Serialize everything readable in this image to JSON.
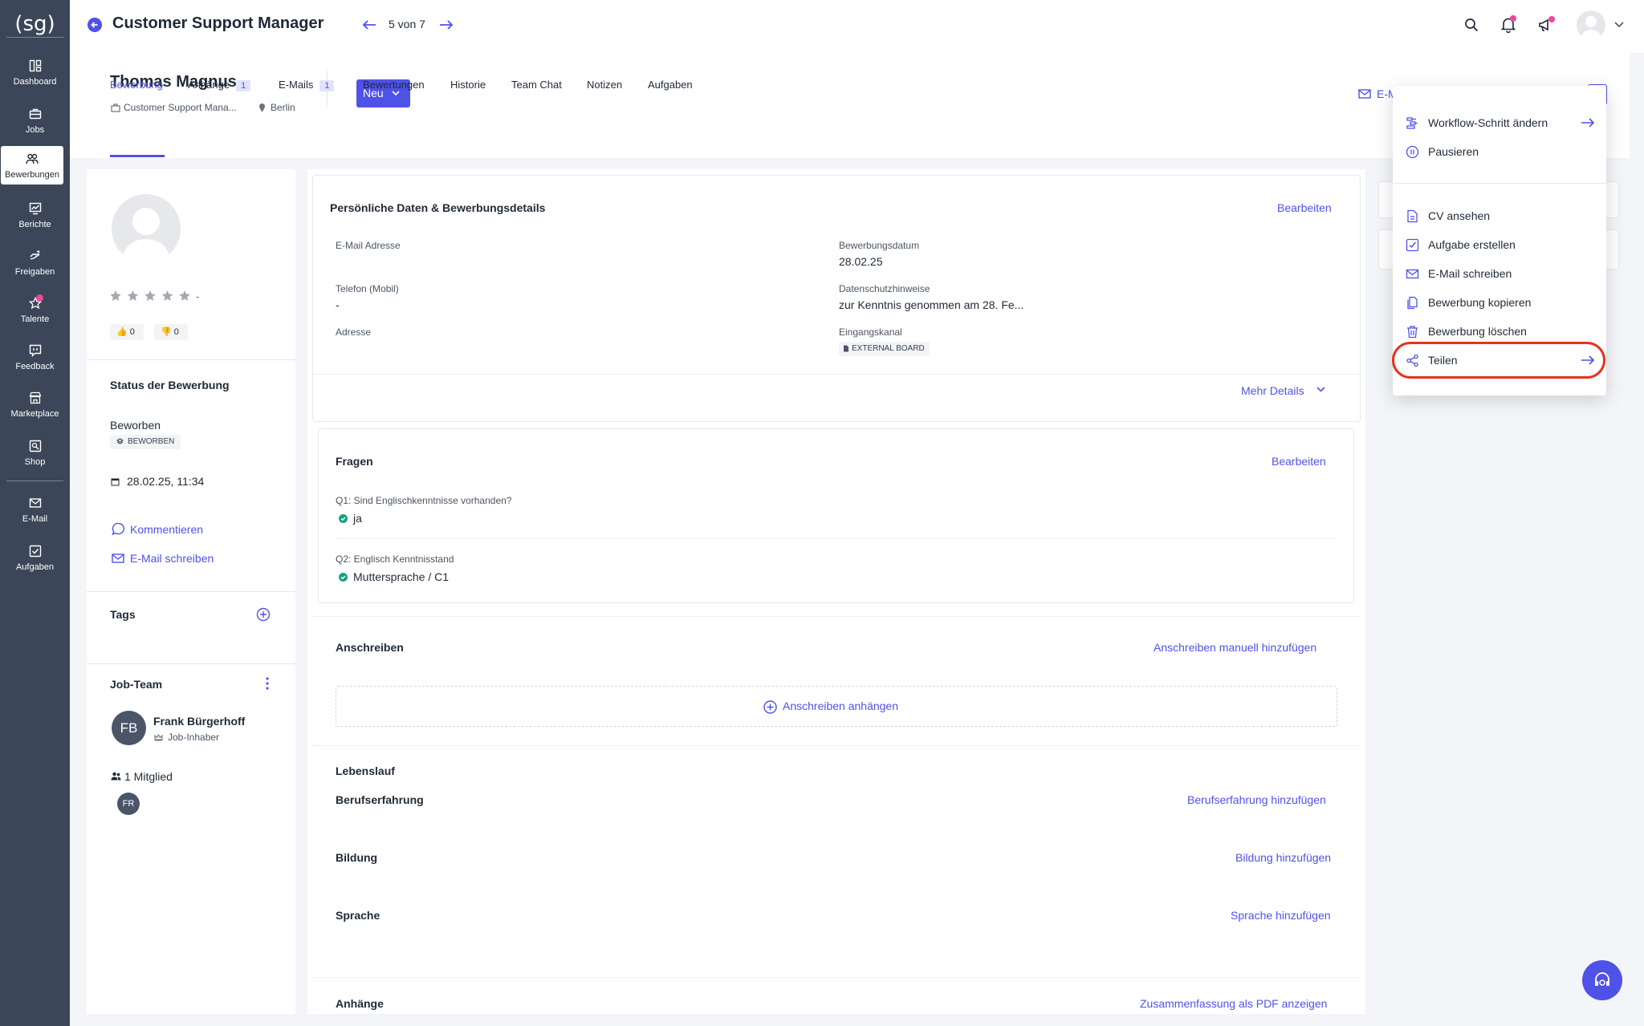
{
  "brand": {
    "logo": "(sg)"
  },
  "sidebar": {
    "items": [
      {
        "label": "Dashboard",
        "icon": "dashboard-icon"
      },
      {
        "label": "Jobs",
        "icon": "briefcase-icon"
      },
      {
        "label": "Bewerbungen",
        "icon": "people-icon"
      },
      {
        "label": "Berichte",
        "icon": "chart-icon"
      },
      {
        "label": "Freigaben",
        "icon": "hand-icon"
      },
      {
        "label": "Talente",
        "icon": "star-icon"
      },
      {
        "label": "Feedback",
        "icon": "feedback-icon"
      },
      {
        "label": "Marketplace",
        "icon": "store-icon"
      },
      {
        "label": "Shop",
        "icon": "shop-icon"
      },
      {
        "label": "E-Mail",
        "icon": "mail-icon"
      },
      {
        "label": "Aufgaben",
        "icon": "task-icon"
      }
    ]
  },
  "topbar": {
    "job_title": "Customer Support Manager",
    "pager": "5 von 7"
  },
  "candidate": {
    "name": "Thomas Magnus",
    "job": "Customer Support Mana...",
    "location": "Berlin",
    "status_button": "Neu",
    "email_button": "E-M"
  },
  "tabs": [
    {
      "label": "Bewerbung",
      "badge": ""
    },
    {
      "label": "Anhänge",
      "badge": "1"
    },
    {
      "label": "E-Mails",
      "badge": "1"
    },
    {
      "label": "Bewertungen",
      "badge": ""
    },
    {
      "label": "Historie",
      "badge": ""
    },
    {
      "label": "Team Chat",
      "badge": ""
    },
    {
      "label": "Notizen",
      "badge": ""
    },
    {
      "label": "Aufgaben",
      "badge": ""
    }
  ],
  "left_panel": {
    "rating_dash": "-",
    "thumbs_up": "0",
    "thumbs_down": "0",
    "status_heading": "Status der Bewerbung",
    "status_value": "Beworben",
    "status_badge": "BEWORBEN",
    "date": "28.02.25, 11:34",
    "comment_link": "Kommentieren",
    "email_link": "E-Mail schreiben",
    "tags_heading": "Tags",
    "team_heading": "Job-Team",
    "member_initials": "FB",
    "member_name": "Frank Bürgerhoff",
    "member_role": "Job-Inhaber",
    "member_count": "1 Mitglied",
    "small_avatar": "FR"
  },
  "details": {
    "heading": "Persönliche Daten & Bewerbungsdetails",
    "edit": "Bearbeiten",
    "email_label": "E-Mail Adresse",
    "phone_label": "Telefon (Mobil)",
    "phone_value": "-",
    "address_label": "Adresse",
    "date_label": "Bewerbungsdatum",
    "date_value": "28.02.25",
    "privacy_label": "Datenschutzhinweise",
    "privacy_value": "zur Kenntnis genommen am 28. Fe...",
    "channel_label": "Eingangskanal",
    "channel_value": "EXTERNAL BOARD",
    "more": "Mehr Details"
  },
  "questions": {
    "heading": "Fragen",
    "edit": "Bearbeiten",
    "q1": "Q1: Sind Englischkenntnisse vorhanden?",
    "a1": "ja",
    "q2": "Q2: Englisch Kenntnisstand",
    "a2": "Muttersprache / C1"
  },
  "cover": {
    "heading": "Anschreiben",
    "add_manual": "Anschreiben manuell hinzufügen",
    "attach": "Anschreiben anhängen"
  },
  "cv": {
    "heading": "Lebenslauf",
    "experience": "Berufserfahrung",
    "experience_add": "Berufserfahrung hinzufügen",
    "education": "Bildung",
    "education_add": "Bildung hinzufügen",
    "language": "Sprache",
    "language_add": "Sprache hinzufügen"
  },
  "attachments": {
    "heading": "Anhänge",
    "pdf_link": "Zusammenfassung als PDF anzeigen"
  },
  "menu": {
    "items": [
      {
        "label": "Workflow-Schritt ändern",
        "icon": "workflow-icon",
        "arrow": true
      },
      {
        "label": "Pausieren",
        "icon": "pause-icon",
        "arrow": false
      },
      {
        "label": "CV ansehen",
        "icon": "document-icon",
        "arrow": false
      },
      {
        "label": "Aufgabe erstellen",
        "icon": "checkbox-icon",
        "arrow": false
      },
      {
        "label": "E-Mail schreiben",
        "icon": "mail-icon",
        "arrow": false
      },
      {
        "label": "Bewerbung kopieren",
        "icon": "copy-icon",
        "arrow": false
      },
      {
        "label": "Bewerbung löschen",
        "icon": "trash-icon",
        "arrow": false
      },
      {
        "label": "Teilen",
        "icon": "share-icon",
        "arrow": true
      }
    ],
    "highlight_color": "#e5341c"
  },
  "colors": {
    "accent": "#4f52e8",
    "sidebar": "#3b4658",
    "badge_pink": "#ec4899",
    "success": "#14a37f"
  }
}
